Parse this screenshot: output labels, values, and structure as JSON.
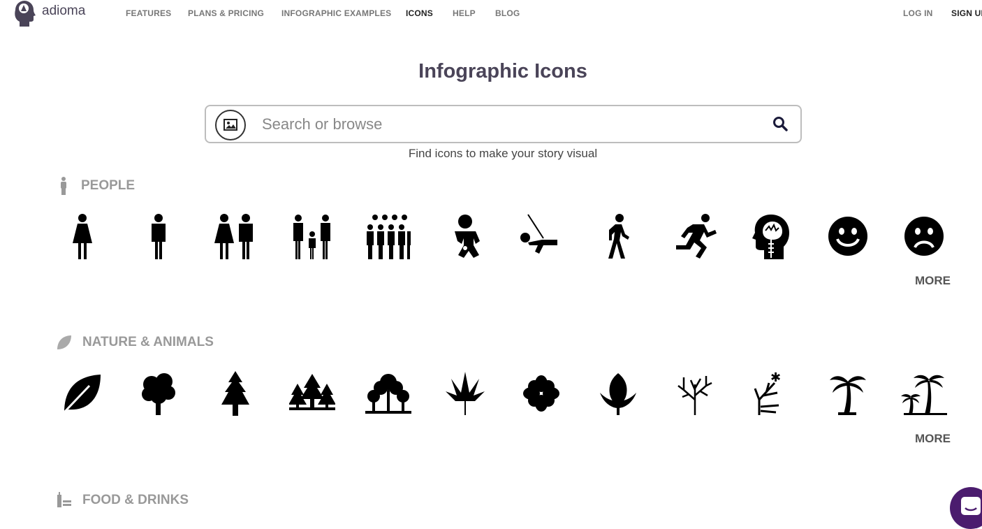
{
  "brand": {
    "name": "adioma"
  },
  "nav": {
    "items": [
      "FEATURES",
      "PLANS & PRICING",
      "INFOGRAPHIC EXAMPLES",
      "ICONS",
      "HELP",
      "BLOG"
    ],
    "login": "LOG IN",
    "signup": "SIGN UP"
  },
  "page": {
    "title": "Infographic Icons",
    "subtitle": "Find icons to make your story visual"
  },
  "search": {
    "placeholder": "Search or browse",
    "value": ""
  },
  "sections": [
    {
      "title": "PEOPLE",
      "more": "MORE"
    },
    {
      "title": "NATURE & ANIMALS",
      "more": "MORE"
    },
    {
      "title": "FOOD & DRINKS"
    }
  ],
  "colors": {
    "brand": "#4a4458",
    "chat": "#4b1c6e"
  }
}
